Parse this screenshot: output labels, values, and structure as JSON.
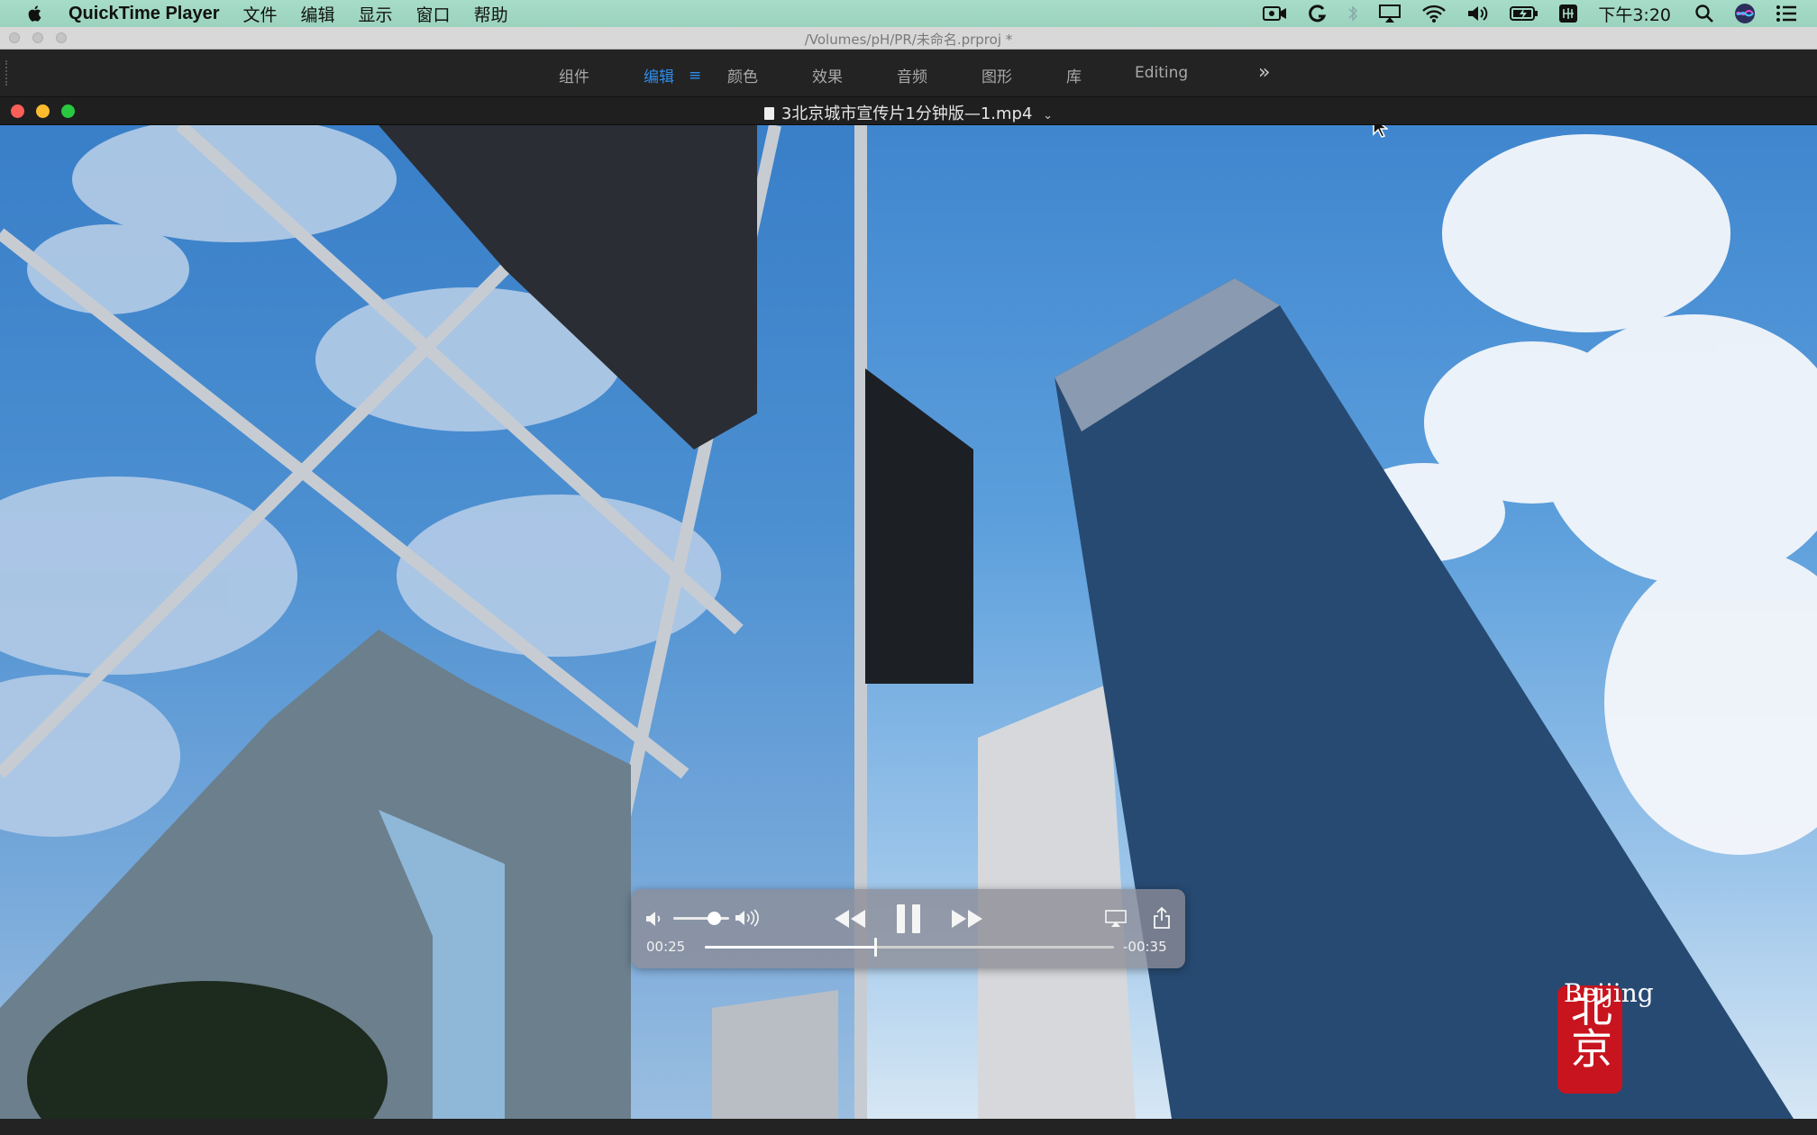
{
  "menubar": {
    "app_name": "QuickTime Player",
    "items": [
      "文件",
      "编辑",
      "显示",
      "窗口",
      "帮助"
    ],
    "clock": "下午3:20",
    "status_icons": [
      "facetime-camera-icon",
      "grammarly-icon",
      "bluetooth-icon",
      "airplay-icon",
      "wifi-icon",
      "volume-icon",
      "battery-icon",
      "input-method-icon",
      "search-icon",
      "siri-icon",
      "notification-center-icon"
    ]
  },
  "project": {
    "path": "/Volumes/pH/PR/未命名.prproj *"
  },
  "workspaces": {
    "tabs": [
      "组件",
      "编辑",
      "颜色",
      "效果",
      "音频",
      "图形",
      "库",
      "Editing"
    ],
    "active": "编辑",
    "more_label": "»"
  },
  "window": {
    "title": "3北京城市宣传片1分钟版—1.mp4"
  },
  "player": {
    "elapsed": "00:25",
    "remaining": "-00:35",
    "progress": 0.417,
    "volume": 0.72
  },
  "video": {
    "seal_text": "北京",
    "caption": "Beijing"
  },
  "colors": {
    "accent": "#2d8ceb",
    "menubar": "#a6dcc8",
    "close": "#fc5f57",
    "minimize": "#fdbc2e",
    "zoom": "#28c840",
    "seal_red": "#c8141e"
  }
}
